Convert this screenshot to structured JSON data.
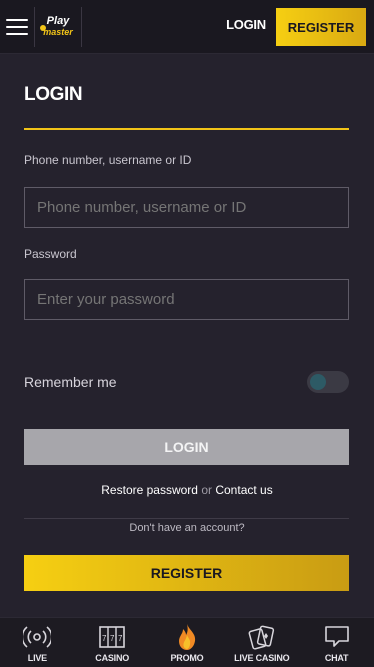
{
  "header": {
    "logo_line1": "Play",
    "logo_line2": "master",
    "login_label": "LOGIN",
    "register_label": "REGISTER"
  },
  "form": {
    "title": "LOGIN",
    "username_label": "Phone number, username or ID",
    "username_placeholder": "Phone number, username or ID",
    "password_label": "Password",
    "password_placeholder": "Enter your password",
    "remember_label": "Remember me",
    "remember_checked": false,
    "login_button": "LOGIN",
    "restore_link": "Restore password",
    "or_text": "or",
    "contact_link": "Contact us",
    "no_account_text": "Don't have an account?",
    "register_button": "REGISTER"
  },
  "tabbar": {
    "items": [
      {
        "label": "LIVE",
        "icon": "live-icon"
      },
      {
        "label": "CASINO",
        "icon": "slot-icon"
      },
      {
        "label": "PROMO",
        "icon": "flame-icon"
      },
      {
        "label": "LIVE CASINO",
        "icon": "cards-icon"
      },
      {
        "label": "CHAT",
        "icon": "chat-icon"
      }
    ]
  },
  "colors": {
    "accent": "#f2c418",
    "background": "#25222d",
    "topbar": "#1a1820"
  }
}
